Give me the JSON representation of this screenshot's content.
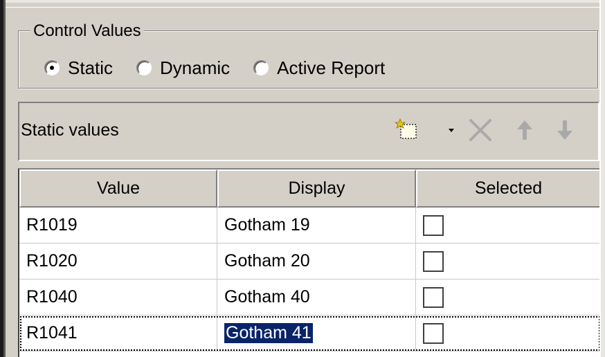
{
  "control_values": {
    "title": "Control Values",
    "options": [
      {
        "label": "Static",
        "checked": true
      },
      {
        "label": "Dynamic",
        "checked": false
      },
      {
        "label": "Active Report",
        "checked": false
      }
    ]
  },
  "toolbar": {
    "label": "Static values",
    "icons": [
      "new-item-icon",
      "dropdown-arrow-icon",
      "delete-icon",
      "move-up-icon",
      "move-down-icon"
    ]
  },
  "table": {
    "columns": [
      "Value",
      "Display",
      "Selected"
    ],
    "rows": [
      {
        "value": "R1019",
        "display": "Gotham 19",
        "selected": false
      },
      {
        "value": "R1020",
        "display": "Gotham 20",
        "selected": false
      },
      {
        "value": "R1040",
        "display": "Gotham 40",
        "selected": false
      },
      {
        "value": "R1041",
        "display": "Gotham 41",
        "selected": false
      }
    ]
  },
  "colors": {
    "background": "#d4d0c8",
    "selection": "#0a246a",
    "icon_disabled": "#a9a9a9"
  }
}
